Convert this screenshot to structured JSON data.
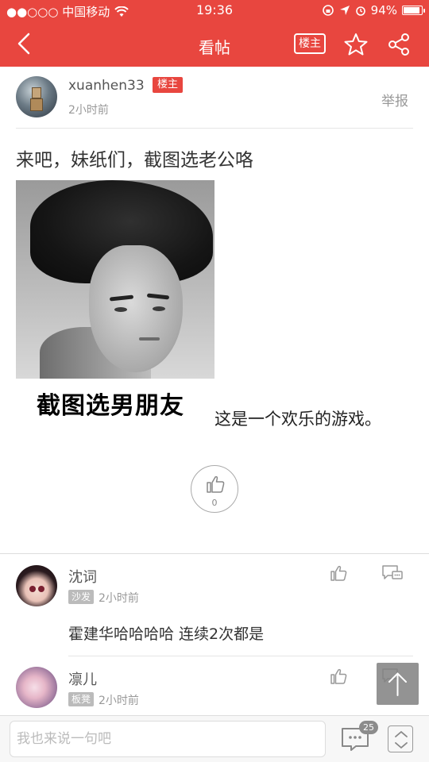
{
  "status_bar": {
    "carrier": "●●○○○ 中国移动",
    "time": "19:36",
    "battery": "94%",
    "battery_level": 0.94
  },
  "header": {
    "title": "看帖",
    "owner_only_label": "楼主",
    "back_icon": "chevron-left-icon",
    "favorite_icon": "star-icon",
    "share_icon": "share-icon",
    "brand_color": "#e8463f"
  },
  "post": {
    "author": "xuanhen33",
    "owner_badge": "楼主",
    "time": "2小时前",
    "report_label": "举报",
    "title": "来吧，妹纸们，截图选老公咯",
    "image_caption": "截图选男朋友",
    "body_text": "这是一个欢乐的游戏。",
    "like_count": "0"
  },
  "comments": [
    {
      "name": "沈词",
      "floor_label": "沙发",
      "time": "2小时前",
      "content": "霍建华哈哈哈哈 连续2次都是"
    },
    {
      "name": "凛儿",
      "floor_label": "板凳",
      "time": "2小时前",
      "content": ""
    }
  ],
  "bottom_bar": {
    "input_placeholder": "我也来说一句吧",
    "comment_count": "25"
  }
}
